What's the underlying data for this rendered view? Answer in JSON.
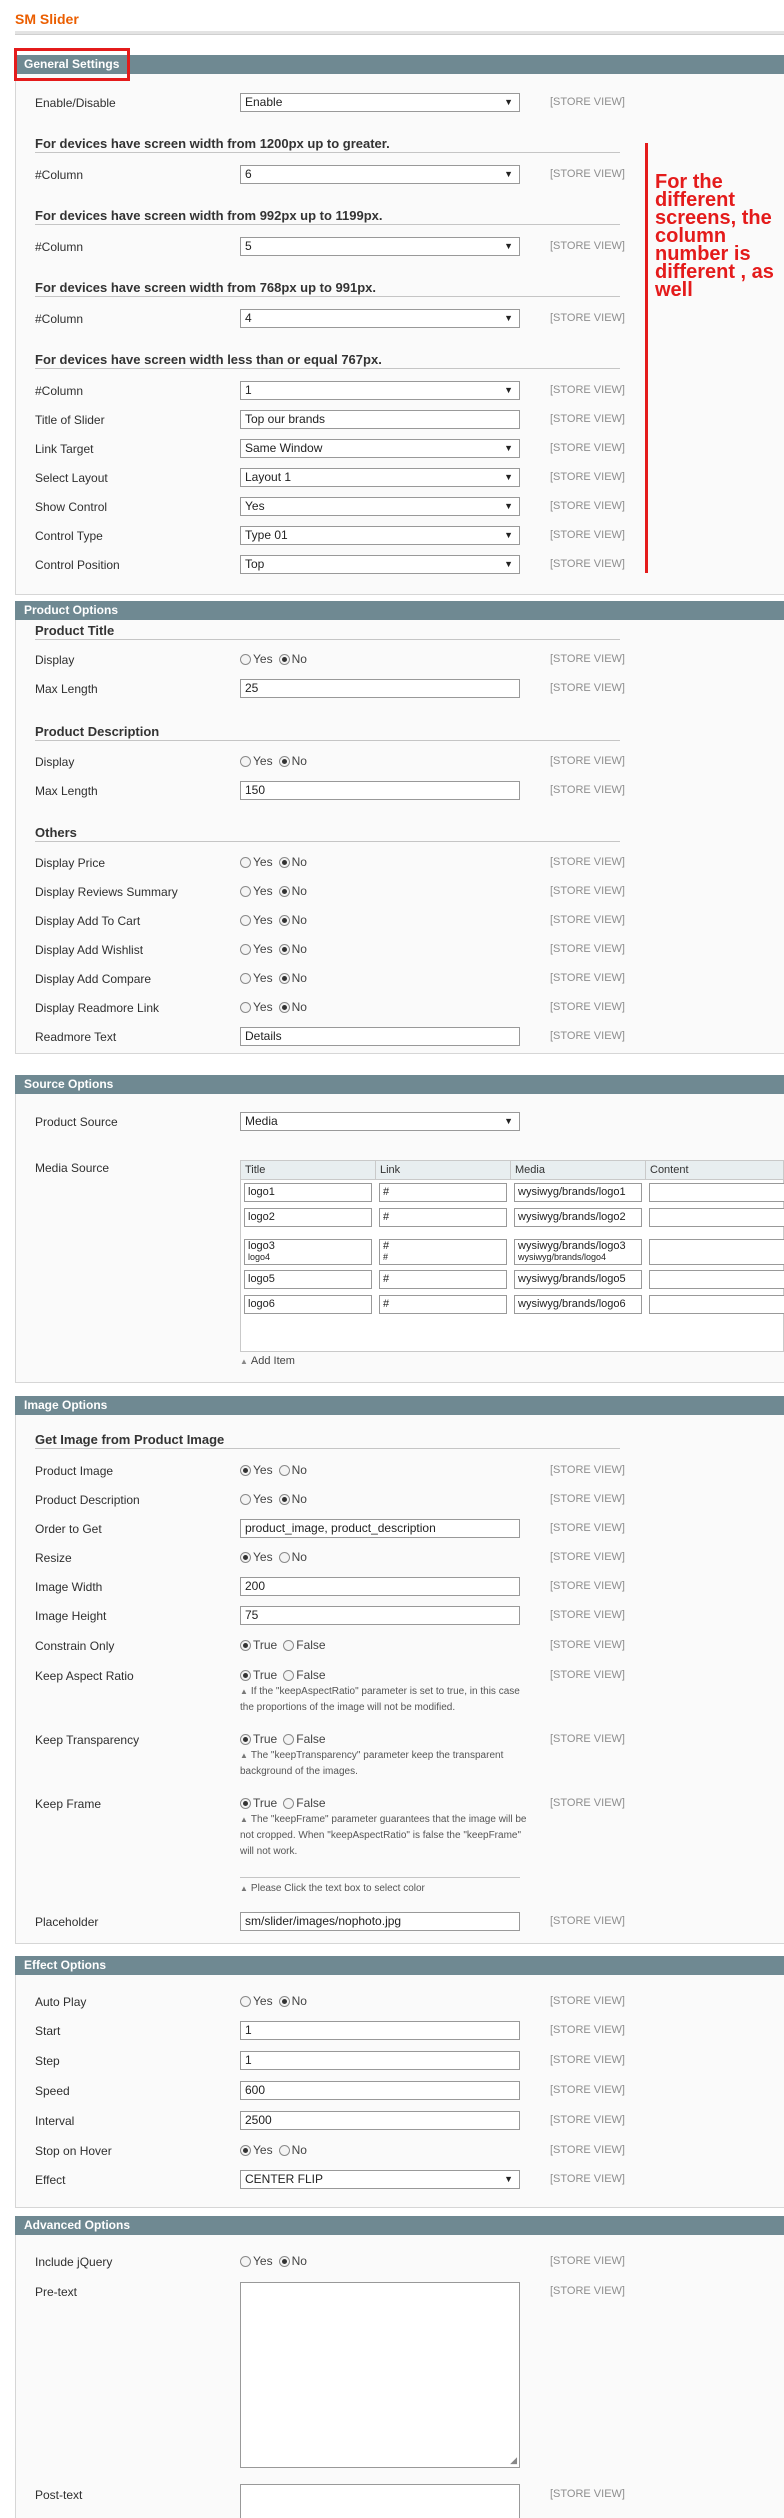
{
  "page_title": "SM Slider",
  "scope_label": "[STORE VIEW]",
  "sections": {
    "general": "General Settings",
    "product": "Product Options",
    "source": "Source Options",
    "image": "Image Options",
    "effect": "Effect Options",
    "advanced": "Advanced Options"
  },
  "annotation": "For the different screens, the column number is different , as well",
  "general": {
    "enable_label": "Enable/Disable",
    "enable_value": "Enable",
    "h1200": "For devices have screen width from 1200px up to greater.",
    "h992": "For devices have screen width from 992px up to 1199px.",
    "h768": "For devices have screen width from 768px up to 991px.",
    "h767": "For devices have screen width less than or equal 767px.",
    "column_label": "#Column",
    "col_1200": "6",
    "col_992": "5",
    "col_768": "4",
    "col_767": "1",
    "title_label": "Title of Slider",
    "title_value": "Top our brands",
    "link_target_label": "Link Target",
    "link_target_value": "Same Window",
    "layout_label": "Select Layout",
    "layout_value": "Layout 1",
    "show_control_label": "Show Control",
    "show_control_value": "Yes",
    "control_type_label": "Control Type",
    "control_type_value": "Type 01",
    "control_position_label": "Control Position",
    "control_position_value": "Top"
  },
  "radio": {
    "yes": "Yes",
    "no": "No",
    "true": "True",
    "false": "False"
  },
  "product": {
    "title_head": "Product Title",
    "display_label": "Display",
    "max_length_label": "Max Length",
    "title_max_length": "25",
    "desc_head": "Product Description",
    "desc_max_length": "150",
    "others_head": "Others",
    "price_label": "Display Price",
    "reviews_label": "Display Reviews Summary",
    "cart_label": "Display Add To Cart",
    "wishlist_label": "Display Add Wishlist",
    "compare_label": "Display Add Compare",
    "readmore_link_label": "Display Readmore Link",
    "readmore_text_label": "Readmore Text",
    "readmore_text_value": "Details"
  },
  "source": {
    "product_source_label": "Product Source",
    "product_source_value": "Media",
    "media_source_label": "Media Source",
    "columns": [
      "Title",
      "Link",
      "Media",
      "Content"
    ],
    "rows": [
      {
        "title": "logo1",
        "link": "#",
        "media": "wysiwyg/brands/logo1"
      },
      {
        "title": "logo2",
        "link": "#",
        "media": "wysiwyg/brands/logo2"
      },
      {
        "title": "logo3",
        "link": "#",
        "media": "wysiwyg/brands/logo3"
      },
      {
        "title": "logo4",
        "link": "#",
        "media": "wysiwyg/brands/logo4"
      },
      {
        "title": "logo5",
        "link": "#",
        "media": "wysiwyg/brands/logo5"
      },
      {
        "title": "logo6",
        "link": "#",
        "media": "wysiwyg/brands/logo6"
      }
    ],
    "add_item": "Add Item"
  },
  "image": {
    "head": "Get Image from Product Image",
    "product_image_label": "Product Image",
    "product_desc_label": "Product Description",
    "order_label": "Order to Get",
    "order_value": "product_image, product_description",
    "resize_label": "Resize",
    "width_label": "Image Width",
    "width_value": "200",
    "height_label": "Image Height",
    "height_value": "75",
    "constrain_label": "Constrain Only",
    "aspect_label": "Keep Aspect Ratio",
    "aspect_note": "If the \"keepAspectRatio\" parameter is set to true, in this case the proportions of the image will not be modified.",
    "transparency_label": "Keep Transparency",
    "transparency_note": "The \"keepTransparency\" parameter keep the transparent background of the images.",
    "frame_label": "Keep Frame",
    "frame_note": "The \"keepFrame\" parameter guarantees that the image will be not cropped. When \"keepAspectRatio\" is false the \"keepFrame\" will not work.",
    "color_note": "Please Click the text box to select color",
    "placeholder_label": "Placeholder",
    "placeholder_value": "sm/slider/images/nophoto.jpg"
  },
  "effect": {
    "autoplay_label": "Auto Play",
    "start_label": "Start",
    "start_value": "1",
    "step_label": "Step",
    "step_value": "1",
    "speed_label": "Speed",
    "speed_value": "600",
    "interval_label": "Interval",
    "interval_value": "2500",
    "hover_label": "Stop on Hover",
    "effect_label": "Effect",
    "effect_value": "CENTER FLIP"
  },
  "advanced": {
    "jquery_label": "Include jQuery",
    "pretext_label": "Pre-text",
    "posttext_label": "Post-text"
  },
  "colors": {
    "accent": "#eb5e00",
    "section_header": "#6f8992",
    "annotation_red": "#e41b1b"
  }
}
